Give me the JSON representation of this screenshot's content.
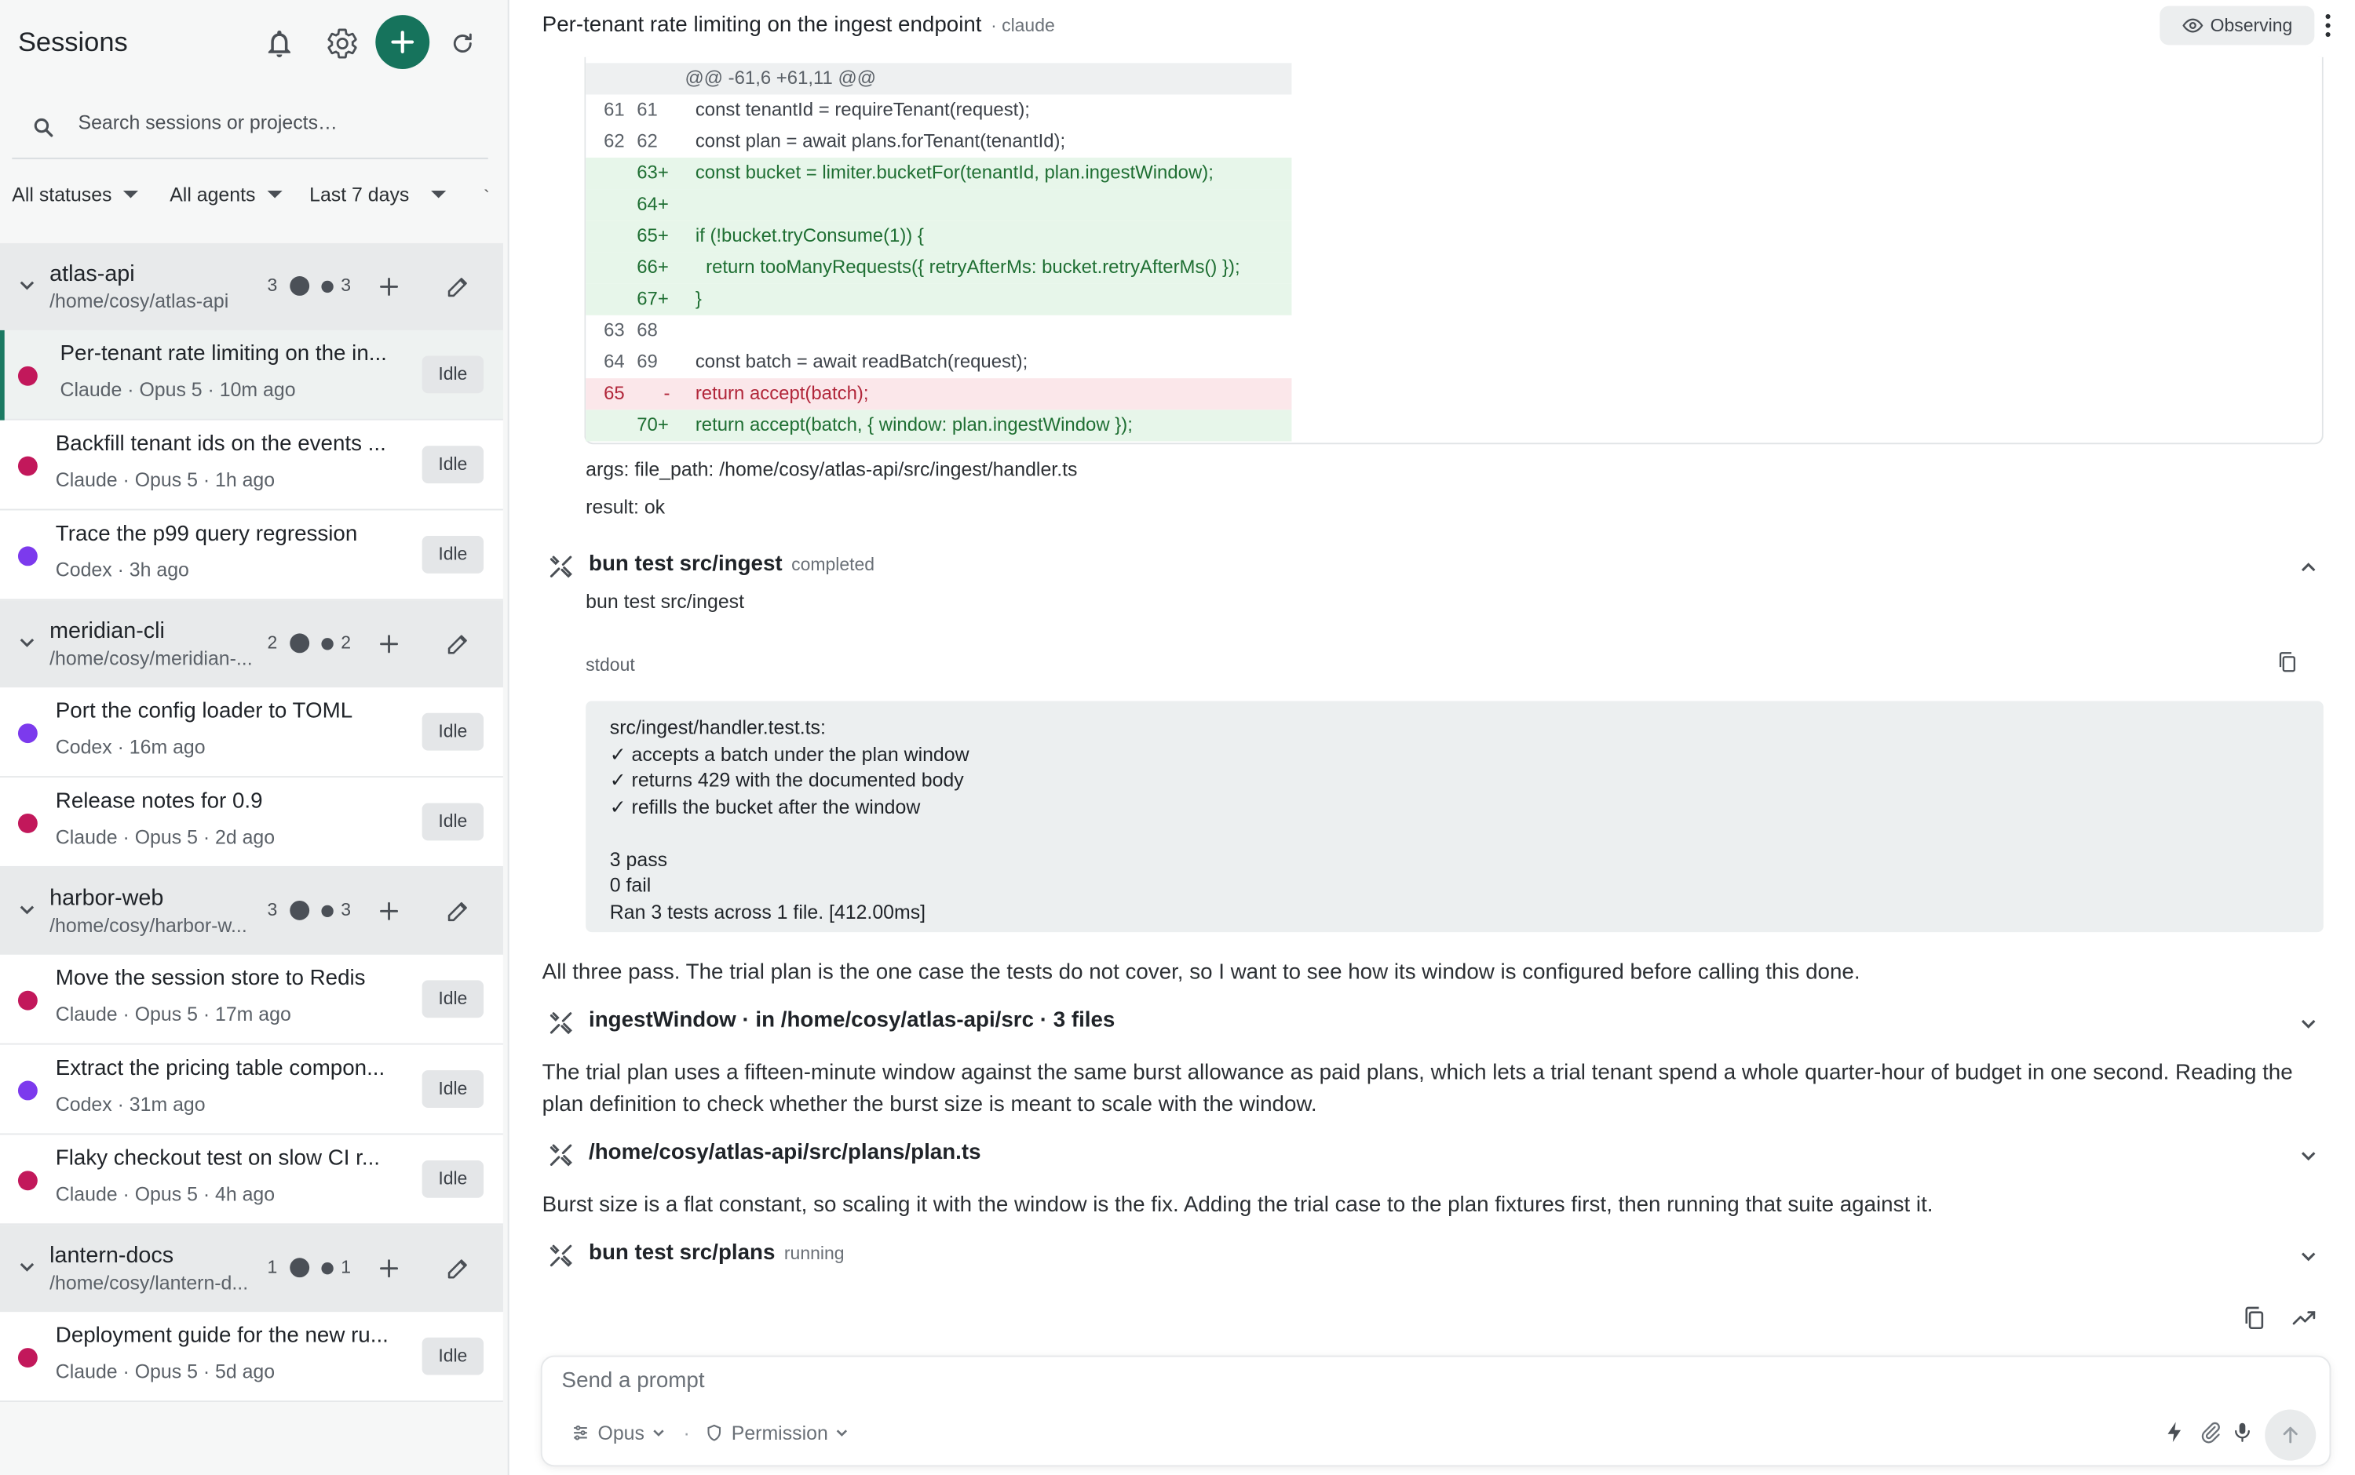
{
  "sidebar": {
    "title": "Sessions",
    "search_placeholder": "Search sessions or projects…",
    "filters": {
      "status": "All statuses",
      "agent": "All agents",
      "range": "Last 7 days",
      "overflow": "`"
    },
    "groups": [
      {
        "name": "atlas-api",
        "path": "/home/cosy/atlas-api",
        "count_a": "3",
        "count_b": "3",
        "sessions": [
          {
            "title": "Per-tenant rate limiting on the in...",
            "meta": "Claude · Opus 5 · 10m ago",
            "badge": "Idle",
            "color": "#c2185b"
          },
          {
            "title": "Backfill tenant ids on the events ...",
            "meta": "Claude · Opus 5 · 1h ago",
            "badge": "Idle",
            "color": "#c2185b"
          },
          {
            "title": "Trace the p99 query regression",
            "meta": "Codex · 3h ago",
            "badge": "Idle",
            "color": "#7c3aed"
          }
        ]
      },
      {
        "name": "meridian-cli",
        "path": "/home/cosy/meridian-...",
        "count_a": "2",
        "count_b": "2",
        "sessions": [
          {
            "title": "Port the config loader to TOML",
            "meta": "Codex · 16m ago",
            "badge": "Idle",
            "color": "#7c3aed"
          },
          {
            "title": "Release notes for 0.9",
            "meta": "Claude · Opus 5 · 2d ago",
            "badge": "Idle",
            "color": "#c2185b"
          }
        ]
      },
      {
        "name": "harbor-web",
        "path": "/home/cosy/harbor-w...",
        "count_a": "3",
        "count_b": "3",
        "sessions": [
          {
            "title": "Move the session store to Redis",
            "meta": "Claude · Opus 5 · 17m ago",
            "badge": "Idle",
            "color": "#c2185b"
          },
          {
            "title": "Extract the pricing table compon...",
            "meta": "Codex · 31m ago",
            "badge": "Idle",
            "color": "#7c3aed"
          },
          {
            "title": "Flaky checkout test on slow CI r...",
            "meta": "Claude · Opus 5 · 4h ago",
            "badge": "Idle",
            "color": "#c2185b"
          }
        ]
      },
      {
        "name": "lantern-docs",
        "path": "/home/cosy/lantern-d...",
        "count_a": "1",
        "count_b": "1",
        "sessions": [
          {
            "title": "Deployment guide for the new ru...",
            "meta": "Claude · Opus 5 · 5d ago",
            "badge": "Idle",
            "color": "#c2185b"
          }
        ]
      }
    ]
  },
  "main": {
    "title": "Per-tenant rate limiting on the ingest endpoint",
    "agent": "· claude",
    "observing": "Observing",
    "diff": [
      {
        "type": "hunk",
        "n1": "",
        "n2": "",
        "sign": "",
        "code": "@@ -61,6 +61,11 @@"
      },
      {
        "type": "ctx",
        "n1": "61",
        "n2": "61",
        "sign": "",
        "code": "const tenantId = requireTenant(request);"
      },
      {
        "type": "ctx",
        "n1": "62",
        "n2": "62",
        "sign": "",
        "code": "const plan = await plans.forTenant(tenantId);"
      },
      {
        "type": "add",
        "n1": "",
        "n2": "63+",
        "sign": "",
        "code": "const bucket = limiter.bucketFor(tenantId, plan.ingestWindow);"
      },
      {
        "type": "add",
        "n1": "",
        "n2": "64+",
        "sign": "",
        "code": ""
      },
      {
        "type": "add",
        "n1": "",
        "n2": "65+",
        "sign": "",
        "code": "if (!bucket.tryConsume(1)) {"
      },
      {
        "type": "add",
        "n1": "",
        "n2": "66+",
        "sign": "",
        "code": "  return tooManyRequests({ retryAfterMs: bucket.retryAfterMs() });"
      },
      {
        "type": "add",
        "n1": "",
        "n2": "67+",
        "sign": "",
        "code": "}"
      },
      {
        "type": "ctx",
        "n1": "63",
        "n2": "68",
        "sign": "",
        "code": ""
      },
      {
        "type": "ctx",
        "n1": "64",
        "n2": "69",
        "sign": "",
        "code": "const batch = await readBatch(request);"
      },
      {
        "type": "del",
        "n1": "65",
        "n2": "",
        "sign": "-",
        "code": "return accept(batch);"
      },
      {
        "type": "add",
        "n1": "",
        "n2": "70+",
        "sign": "",
        "code": "return accept(batch, { window: plan.ingestWindow });"
      }
    ],
    "args_line": "args: file_path: /home/cosy/atlas-api/src/ingest/handler.ts",
    "result_line": "result: ok",
    "tool1": {
      "name": "bun test src/ingest",
      "status": "completed",
      "command": "bun test src/ingest"
    },
    "stdout_label": "stdout",
    "stdout": "src/ingest/handler.test.ts:\n✓ accepts a batch under the plan window\n✓ returns 429 with the documented body\n✓ refills the bucket after the window\n\n3 pass\n0 fail\nRan 3 tests across 1 file. [412.00ms]",
    "para1": "All three pass. The trial plan is the one case the tests do not cover, so I want to see how its window is configured before calling this done.",
    "tool2": {
      "name": "ingestWindow · in /home/cosy/atlas-api/src · 3 files"
    },
    "para2": "The trial plan uses a fifteen-minute window against the same burst allowance as paid plans, which lets a trial tenant spend a whole quarter-hour of budget in one second. Reading the plan definition to check whether the burst size is meant to scale with the window.",
    "tool3": {
      "name": "/home/cosy/atlas-api/src/plans/plan.ts"
    },
    "para3": "Burst size is a flat constant, so scaling it with the window is the fix. Adding the trial case to the plan fixtures first, then running that suite against it.",
    "tool4": {
      "name": "bun test src/plans",
      "status": "running"
    },
    "prompt": {
      "placeholder": "Send a prompt",
      "model": "Opus",
      "separator": "·",
      "permission": "Permission"
    }
  }
}
